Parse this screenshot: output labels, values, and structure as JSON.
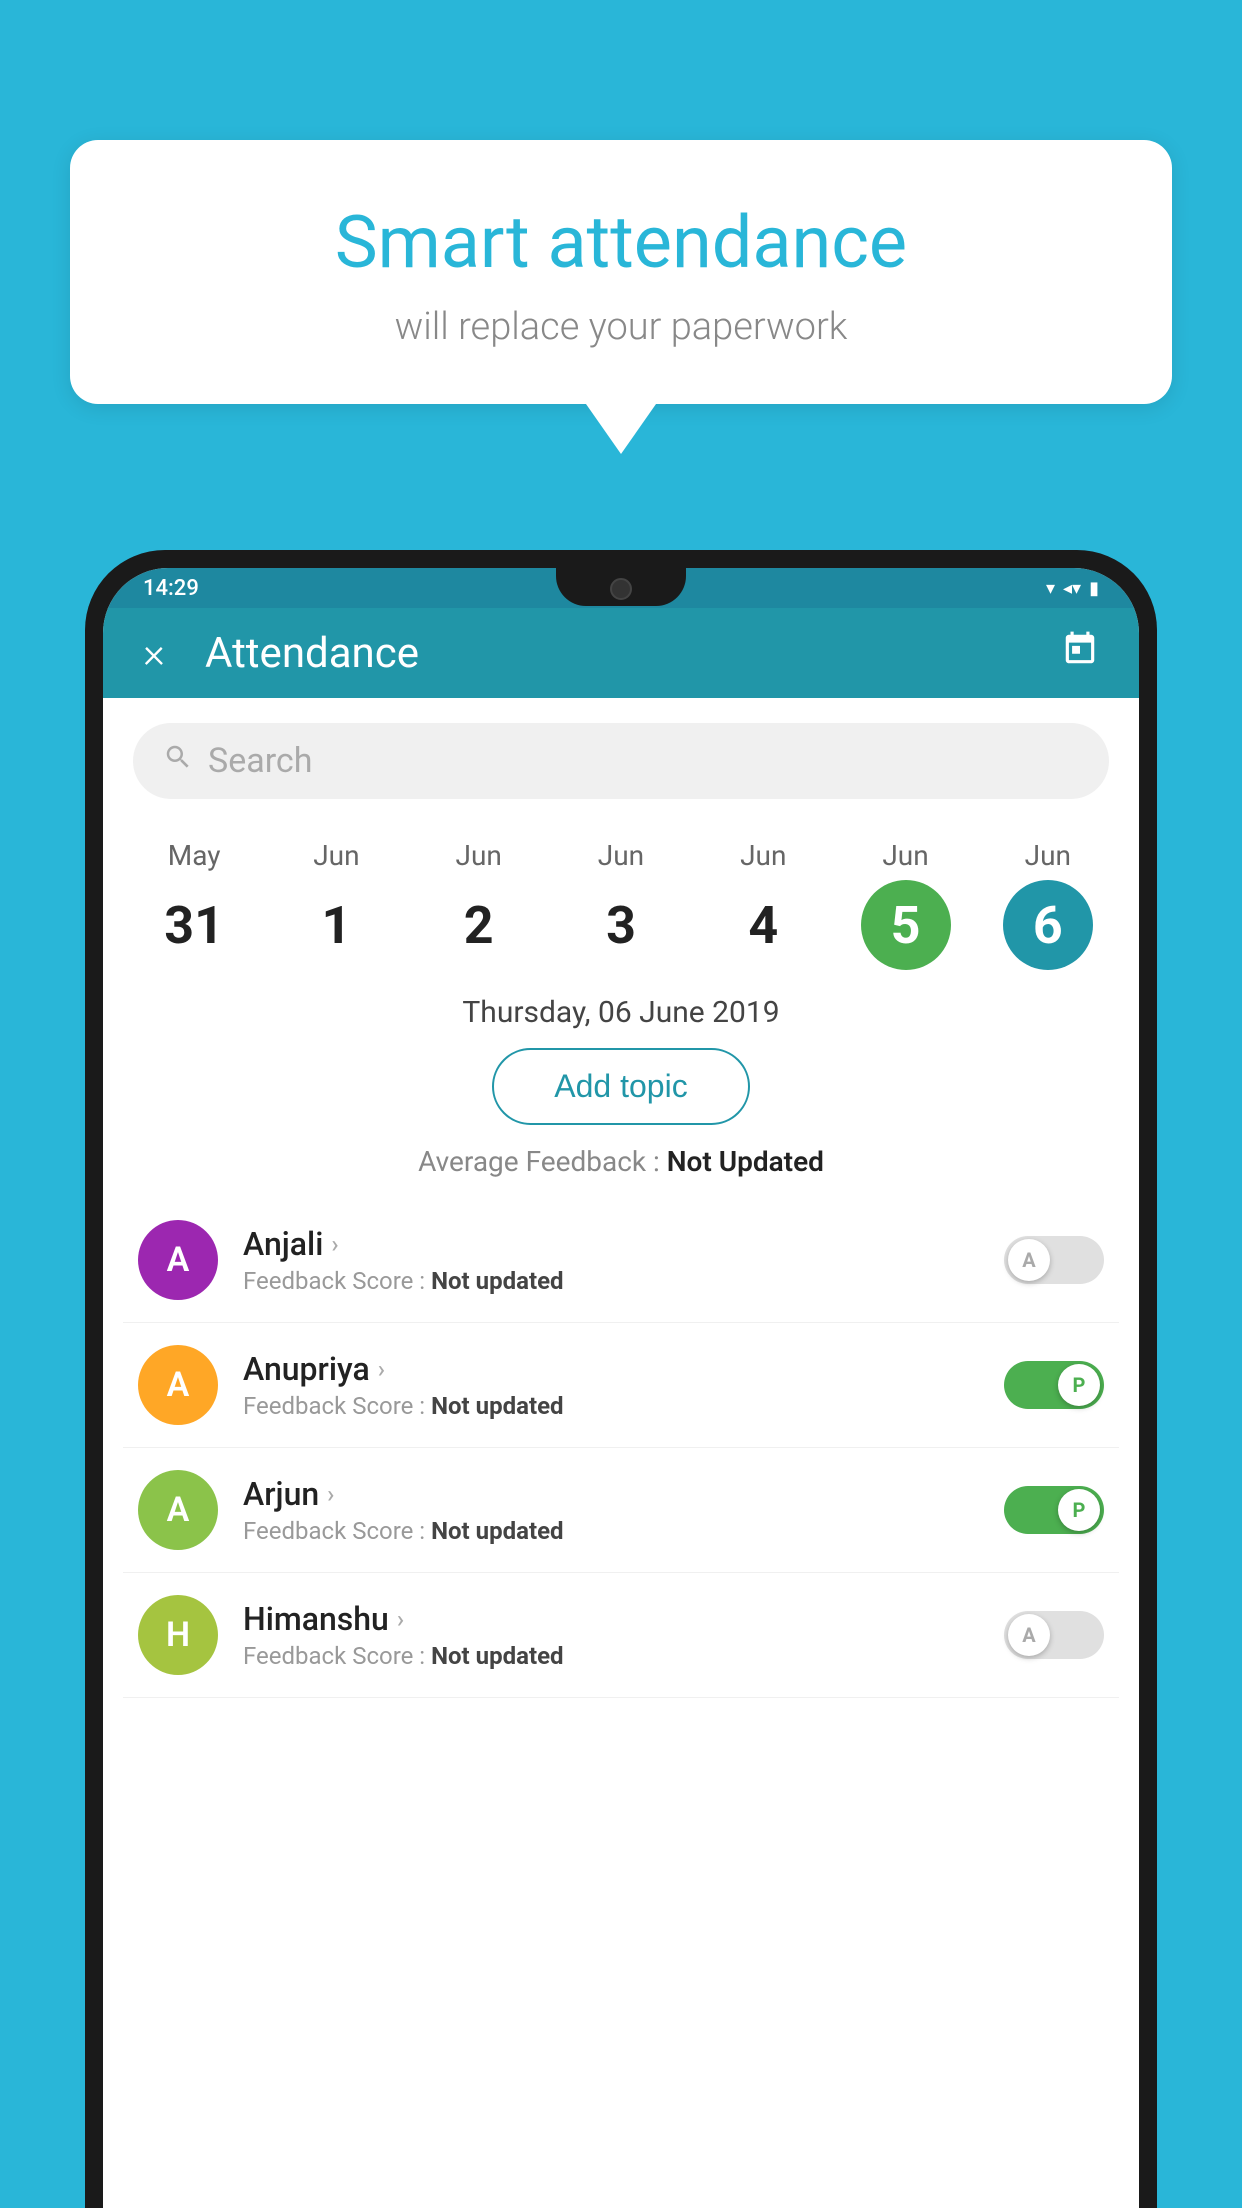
{
  "background": {
    "color": "#29b6d8"
  },
  "bubble": {
    "title": "Smart attendance",
    "subtitle": "will replace your paperwork"
  },
  "status_bar": {
    "time": "14:29",
    "icons": [
      "▼",
      "◀",
      "▮"
    ]
  },
  "header": {
    "title": "Attendance",
    "close_label": "×",
    "calendar_icon": "📅"
  },
  "search": {
    "placeholder": "Search"
  },
  "date_strip": {
    "dates": [
      {
        "month": "May",
        "day": "31",
        "state": "normal"
      },
      {
        "month": "Jun",
        "day": "1",
        "state": "normal"
      },
      {
        "month": "Jun",
        "day": "2",
        "state": "normal"
      },
      {
        "month": "Jun",
        "day": "3",
        "state": "normal"
      },
      {
        "month": "Jun",
        "day": "4",
        "state": "normal"
      },
      {
        "month": "Jun",
        "day": "5",
        "state": "today"
      },
      {
        "month": "Jun",
        "day": "6",
        "state": "selected"
      }
    ]
  },
  "selected_date": {
    "label": "Thursday, 06 June 2019"
  },
  "add_topic": {
    "label": "Add topic"
  },
  "avg_feedback": {
    "prefix": "Average Feedback : ",
    "value": "Not Updated"
  },
  "students": [
    {
      "name": "Anjali",
      "avatar_letter": "A",
      "avatar_color": "#9c27b0",
      "feedback": "Feedback Score : ",
      "feedback_value": "Not updated",
      "attendance": "absent",
      "toggle_letter": "A"
    },
    {
      "name": "Anupriya",
      "avatar_letter": "A",
      "avatar_color": "#ffa726",
      "feedback": "Feedback Score : ",
      "feedback_value": "Not updated",
      "attendance": "present",
      "toggle_letter": "P"
    },
    {
      "name": "Arjun",
      "avatar_letter": "A",
      "avatar_color": "#8bc34a",
      "feedback": "Feedback Score : ",
      "feedback_value": "Not updated",
      "attendance": "present",
      "toggle_letter": "P"
    },
    {
      "name": "Himanshu",
      "avatar_letter": "H",
      "avatar_color": "#a5c440",
      "feedback": "Feedback Score : ",
      "feedback_value": "Not updated",
      "attendance": "absent",
      "toggle_letter": "A"
    }
  ]
}
